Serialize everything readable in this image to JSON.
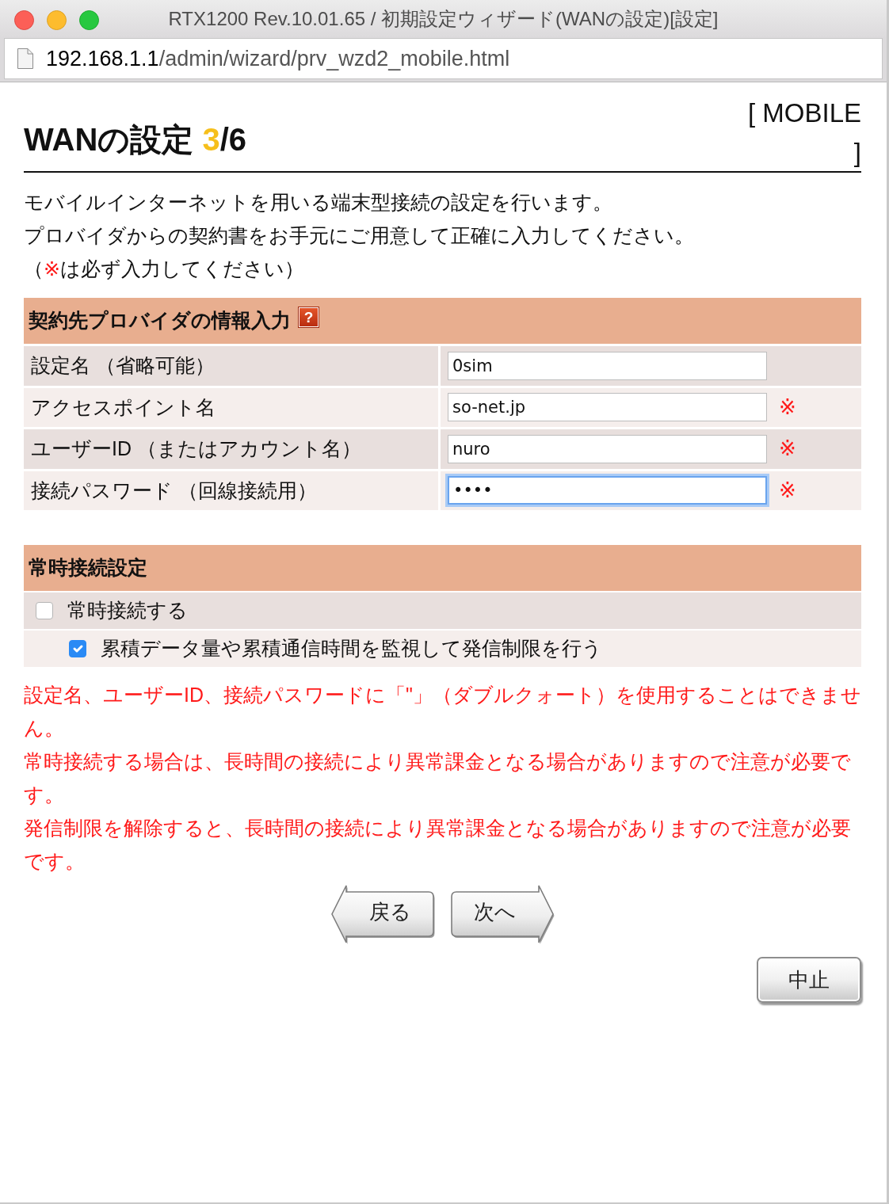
{
  "window": {
    "title": "RTX1200 Rev.10.01.65 / 初期設定ウィザード(WANの設定)[設定]"
  },
  "address_bar": {
    "host": "192.168.1.1",
    "path": "/admin/wizard/prv_wzd2_mobile.html"
  },
  "heading": {
    "title": "WANの設定",
    "step": "3",
    "total": "/6",
    "mode": "[ MOBILE ]"
  },
  "intro": [
    "モバイルインターネットを用いる端末型接続の設定を行います。",
    "プロバイダからの契約書をお手元にご用意して正確に入力してください。"
  ],
  "required_note": {
    "open": "（",
    "mark": "※",
    "text": "は必ず入力してください）"
  },
  "sections": [
    {
      "kind": "fields",
      "title": "契約先プロバイダの情報入力",
      "help": "?",
      "rows": [
        {
          "label": "設定名 （省略可能）",
          "value": "0sim",
          "focused": false
        },
        {
          "label": "アクセスポイント名",
          "value": "so-net.jp",
          "focused": false,
          "mark": "※"
        },
        {
          "label": "ユーザーID （またはアカウント名）",
          "value": "nuro",
          "focused": false,
          "mark": "※"
        },
        {
          "label": "接続パスワード （回線接続用）",
          "value": "••••",
          "focused": true,
          "mark": "※"
        }
      ]
    },
    {
      "kind": "options",
      "title": "常時接続設定",
      "options": [
        {
          "label": "常時接続する",
          "checked": false,
          "children": [
            {
              "label": "累積データ量や累積通信時間を監視して発信制限を行う",
              "checked": true
            }
          ]
        }
      ]
    }
  ],
  "warnings": [
    "設定名、ユーザーID、接続パスワードに「\"」（ダブルクォート）を使用することはできません。",
    "常時接続する場合は、長時間の接続により異常課金となる場合がありますので注意が必要です。",
    "発信制限を解除すると、長時間の接続により異常課金となる場合がありますので注意が必要です。"
  ],
  "nav_buttons": [
    {
      "kind": "back",
      "label": "戻る"
    },
    {
      "kind": "next",
      "label": "次へ"
    }
  ],
  "cancel_button": {
    "label": "中止"
  }
}
